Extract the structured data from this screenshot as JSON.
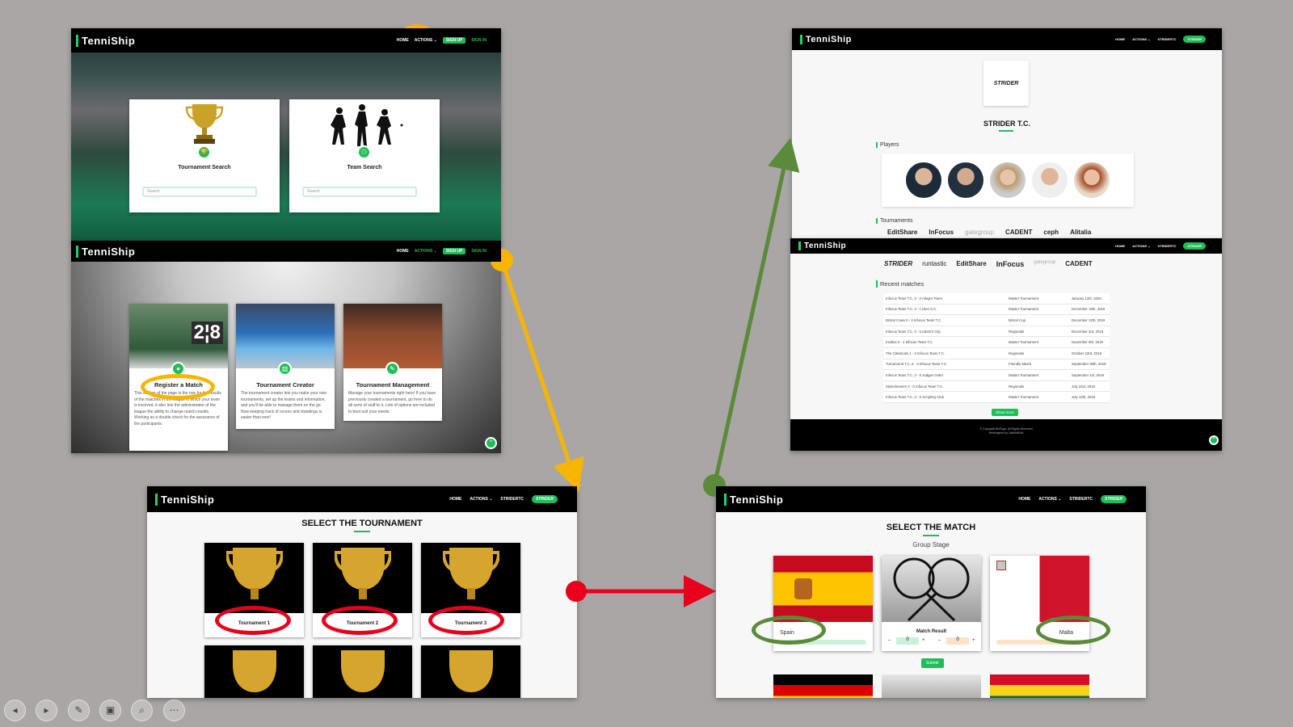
{
  "brand": "TenniShip",
  "screen1": {
    "nav": {
      "home": "HOME",
      "actions": "ACTIONS ⌄",
      "signup": "SIGN UP",
      "signin": "SIGN IN"
    },
    "cards": [
      {
        "title": "Tournament Search",
        "placeholder": "Search",
        "icon": "trophy-icon"
      },
      {
        "title": "Team Search",
        "placeholder": "Search",
        "icon": "team-icon"
      }
    ]
  },
  "screen2": {
    "nav": {
      "home": "HOME",
      "actions": "ACTIONS ⌄",
      "signup": "SIGN UP",
      "signin": "SIGN IN"
    },
    "cards": [
      {
        "title": "Register a Match",
        "desc": "This section of the page is the one for the results of the matches in the league in which your team is involved, it also lets the administrator of the league the ability to change match results. Working as a double check for the assurance of the participants."
      },
      {
        "title": "Tournament Creator",
        "desc": "The tournament creator lets you make your own tournaments, set up the teams and information, and you'll be able to manage them on the go. Now keeping track of scores and standings is easier than ever!"
      },
      {
        "title": "Tournament Management",
        "desc": "Manage your tournaments right here! If you have previously created a tournament, go here to do all sorts of stuff to it. Lots of options are included to best suit your needs."
      }
    ]
  },
  "screen3": {
    "nav": {
      "home": "HOME",
      "actions": "ACTIONS ⌄",
      "team": "STRIDERTC",
      "badge": "STRIDER"
    },
    "heading": "SELECT THE TOURNAMENT",
    "tournaments": [
      "Tournament 1",
      "Tournament 2",
      "Tournament 3"
    ]
  },
  "screen4": {
    "nav": {
      "home": "HOME",
      "actions": "ACTIONS ⌄",
      "team": "STRIDERTC",
      "badge": "STRIDER"
    },
    "heading": "SELECT THE MATCH",
    "stage": "Group Stage",
    "home_team": "Spain",
    "away_team": "Malta",
    "match_label": "Match Result",
    "home_score": "0",
    "away_score": "0",
    "submit": "Submit"
  },
  "screen5": {
    "nav": {
      "home": "HOME",
      "actions": "ACTIONS ⌄",
      "team": "STRIDERTC",
      "badge": "STRIDER"
    },
    "team_logo": "STRIDER",
    "team_name": "STRIDER T.C.",
    "players_label": "Players",
    "tournaments_label": "Tournaments",
    "sponsors_top": [
      "EditShare",
      "InFocus",
      "gategroup",
      "CADENT",
      "ceph",
      "Alitalia"
    ]
  },
  "screen6": {
    "nav": {
      "home": "HOME",
      "actions": "ACTIONS ⌄",
      "team": "STRIDERTC",
      "badge": "STRIDER"
    },
    "sponsors": [
      "STRIDER",
      "runtastic",
      "EditShare",
      "InFocus",
      "gategroup",
      "CADENT"
    ],
    "recent_label": "Recent matches",
    "matches": [
      [
        "Infocus Team T.C. 3 - 0 Allegro Team",
        "Master Tournament",
        "January 12th, 2020"
      ],
      [
        "Infocus Team T.C. 3 - 1 Dies S.C.",
        "Master Tournament",
        "December 19th, 2019"
      ],
      [
        "Bristol Cows 0 - 3 Infocus Team T.C.",
        "Bristol Cup",
        "December 12th, 2019"
      ],
      [
        "Infocus Team T.C. 3 - 0 Adam's City",
        "Regionals",
        "December 3rd, 2019"
      ],
      [
        "Invittus 3 - 1 Infocus Team T.C.",
        "Master Tournament",
        "November 6th, 2019"
      ],
      [
        "The Classicals 1 - 3 Infocus Team T.C.",
        "Regionals",
        "October 23rd, 2019"
      ],
      [
        "Turnaround T.C. 0 - 3 Infocus Team T.C.",
        "Friendly Match",
        "September 30th, 2019"
      ],
      [
        "Infocus Team T.C. 3 - 0 Judges Order",
        "Master Tournament",
        "September 1st, 2019"
      ],
      [
        "Stylesheeters 3 - 0 Infocus Team T.C.",
        "Regionals",
        "July 31st, 2019"
      ],
      [
        "Infocus Team T.C. 3 - 0 Scripting Club",
        "Master Tournament",
        "July 12th, 2019"
      ]
    ],
    "show_more": "Show more",
    "footer1": "© Copyright BizPage. All Rights Reserved",
    "footer2": "Redesigned by JoshWilkins"
  },
  "colors": {
    "accent": "#1fbd5a",
    "yellow": "#f7b500",
    "red": "#e8001c",
    "green_arrow": "#5a8a3a"
  }
}
